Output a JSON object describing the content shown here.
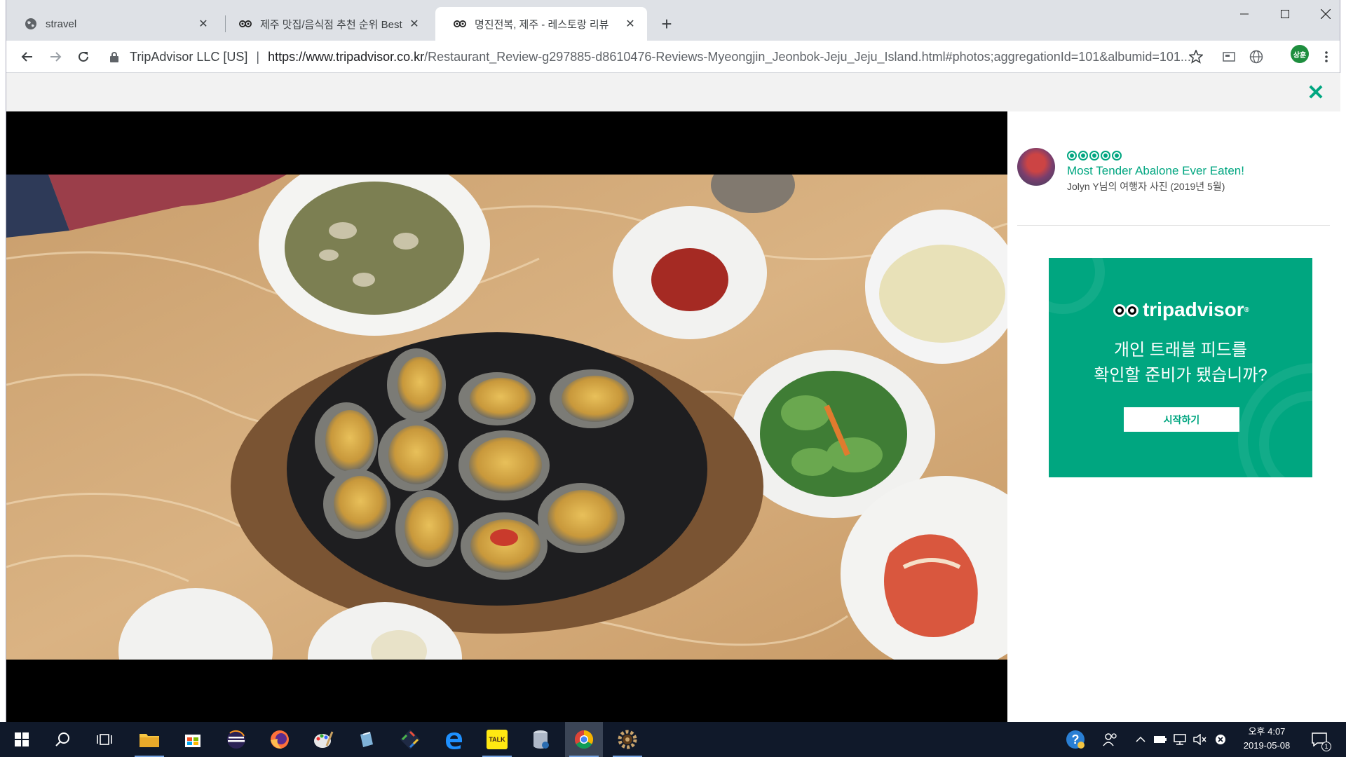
{
  "browser": {
    "tabs": [
      {
        "title": "stravel",
        "icon": "globe-icon",
        "active": false
      },
      {
        "title": "제주 맛집/음식점 추천 순위 Best",
        "icon": "tripadvisor-owl-icon",
        "active": false
      },
      {
        "title": "명진전복, 제주 - 레스토랑 리뷰",
        "icon": "tripadvisor-owl-icon",
        "active": true
      }
    ],
    "new_tab_label": "+",
    "site_owner": "TripAdvisor LLC [US]",
    "url_host": "https://www.tripadvisor.co.kr",
    "url_path": "/Restaurant_Review-g297885-d8610476-Reviews-Myeongjin_Jeonbok-Jeju_Jeju_Island.html#photos;aggregationId=101&albumid=101...",
    "profile_initials": "상훈"
  },
  "photo_viewer": {
    "close_label": "✕",
    "rating_bubbles": 5,
    "photo_title": "Most Tender Abalone Ever Eaten!",
    "photo_byline": "Jolyn Y님의 여행자 사진 (2019년 5월)"
  },
  "ad": {
    "brand": "tripadvisor",
    "headline_line1": "개인 트래블 피드를",
    "headline_line2": "확인할 준비가 됐습니까?",
    "cta_label": "시작하기",
    "bg_color": "#00a680"
  },
  "taskbar": {
    "apps": [
      "start-icon",
      "search-icon",
      "task-view-icon",
      "file-explorer-icon",
      "store-icon",
      "eclipse-icon",
      "firefox-icon",
      "paint-icon",
      "app-icon",
      "git-icon",
      "edge-icon",
      "kakaotalk-icon",
      "database-icon",
      "chrome-icon",
      "settings-gear-icon"
    ],
    "kakaotalk_label": "TALK",
    "clock_period_time": "오후 4:07",
    "clock_date": "2019-05-08",
    "notification_count": "1"
  }
}
